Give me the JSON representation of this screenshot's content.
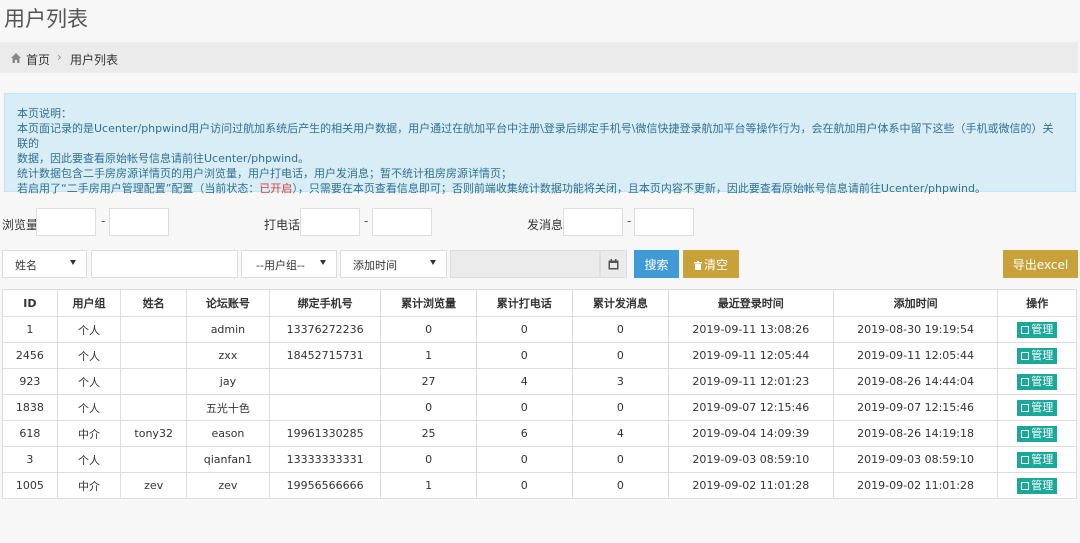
{
  "page_title": "用户列表",
  "breadcrumb": {
    "home": "首页",
    "separator": "›",
    "current": "用户列表"
  },
  "notice": {
    "line1": "本页说明：",
    "line2": "本页面记录的是Ucenter/phpwind用户访问过航加系统后产生的相关用户数据，用户通过在航加平台中注册\\登录后绑定手机号\\微信快捷登录航加平台等操作行为，会在航加用户体系中留下这些（手机或微信的）关联的",
    "line3": "数据，因此要查看原始帐号信息请前往Ucenter/phpwind。",
    "line4": "统计数据包含二手房房源详情页的用户浏览量，用户打电话，用户发消息；暂不统计租房房源详情页；",
    "line5_pre": "若启用了“二手房用户管理配置”配置（当前状态：",
    "line5_status": "已开启",
    "line5_post": "），只需要在本页查看信息即可；否则前端收集统计数据功能将关闭，且本页内容不更新，因此要查看原始帐号信息请前往Ucenter/phpwind。"
  },
  "filters": {
    "views_label": "浏览量",
    "calls_label": "打电话",
    "messages_label": "发消息",
    "dash": "-"
  },
  "search": {
    "field_select": "姓名",
    "group_select": "--用户组--",
    "time_select": "添加时间",
    "search_button": "搜索",
    "clear_button": "清空",
    "export_button": "导出excel"
  },
  "table": {
    "headers": [
      "ID",
      "用户组",
      "姓名",
      "论坛账号",
      "绑定手机号",
      "累计浏览量",
      "累计打电话",
      "累计发消息",
      "最近登录时间",
      "添加时间",
      "操作"
    ],
    "manage_label": "管理",
    "rows": [
      [
        "1",
        "个人",
        "",
        "admin",
        "13376272236",
        "0",
        "0",
        "0",
        "2019-09-11 13:08:26",
        "2019-08-30 19:19:54"
      ],
      [
        "2456",
        "个人",
        "",
        "zxx",
        "18452715731",
        "1",
        "0",
        "0",
        "2019-09-11 12:05:44",
        "2019-09-11 12:05:44"
      ],
      [
        "923",
        "个人",
        "",
        "jay",
        "",
        "27",
        "4",
        "3",
        "2019-09-11 12:01:23",
        "2019-08-26 14:44:04"
      ],
      [
        "1838",
        "个人",
        "",
        "五光十色",
        "",
        "0",
        "0",
        "0",
        "2019-09-07 12:15:46",
        "2019-09-07 12:15:46"
      ],
      [
        "618",
        "中介",
        "tony32",
        "eason",
        "19961330285",
        "25",
        "6",
        "4",
        "2019-09-04 14:09:39",
        "2019-08-26 14:19:18"
      ],
      [
        "3",
        "个人",
        "",
        "qianfan1",
        "13333333331",
        "0",
        "0",
        "0",
        "2019-09-03 08:59:10",
        "2019-09-03 08:59:10"
      ],
      [
        "1005",
        "中介",
        "zev",
        "zev",
        "19956566666",
        "1",
        "0",
        "0",
        "2019-09-02 11:01:28",
        "2019-09-02 11:01:28"
      ]
    ]
  },
  "colors": {
    "search": "#3f9ad6",
    "clear": "#c9a13b",
    "export": "#c9a13b",
    "manage": "#1aa89a",
    "notice_bg": "#d9edf7",
    "status_red": "#e53935"
  }
}
